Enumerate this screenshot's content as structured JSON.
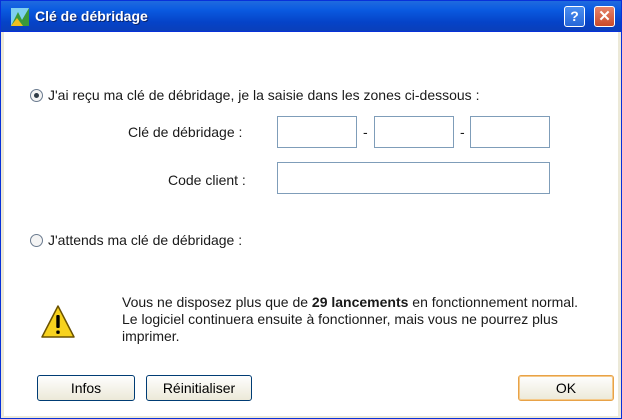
{
  "window": {
    "title": "Clé de débridage"
  },
  "titlebar_buttons": {
    "help": "?",
    "close": "✕"
  },
  "option1": {
    "label": "J'ai reçu ma clé de débridage, je la saisie dans les zones ci-dessous :",
    "selected": true,
    "key_label": "Clé de débridage :",
    "key_separator": "-",
    "key_parts": [
      "",
      "",
      ""
    ],
    "client_label": "Code client :",
    "client_value": ""
  },
  "option2": {
    "label": "J'attends ma clé de débridage :",
    "selected": false
  },
  "warning": {
    "icon": "warning-icon",
    "line1_pre": "Vous ne disposez plus que de ",
    "line1_bold": "29 lancements",
    "line1_post": " en fonctionnement normal.",
    "line2": "Le logiciel continuera ensuite à fonctionner, mais vous ne pourrez plus imprimer."
  },
  "buttons": {
    "infos": "Infos",
    "reset": "Réinitialiser",
    "ok": "OK"
  }
}
